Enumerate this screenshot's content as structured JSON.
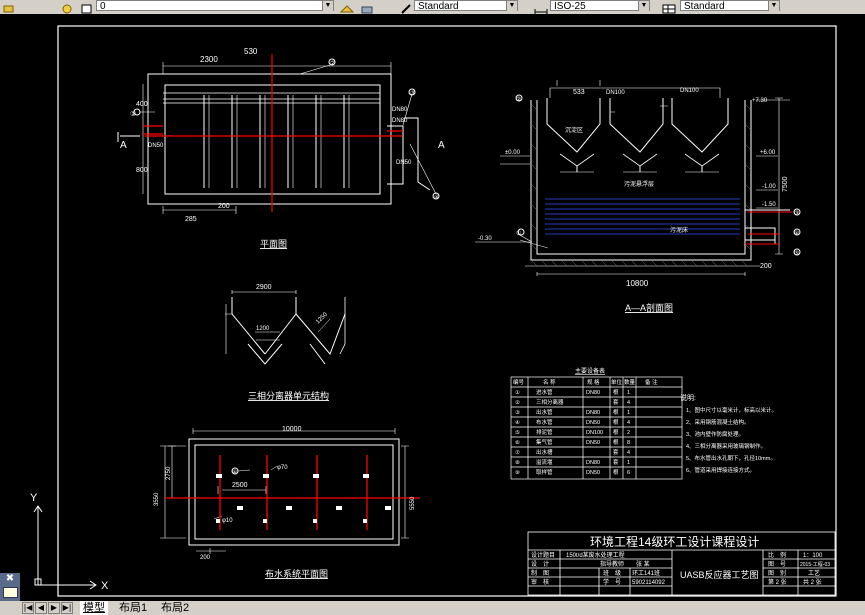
{
  "toolbar": {
    "layer_value": "0",
    "textstyle_value": "Standard",
    "dimstyle_value": "ISO-25",
    "tablestyle_value": "Standard"
  },
  "drawing": {
    "plan": {
      "title": "平面图",
      "dims": [
        "2300",
        "530",
        "400",
        "800",
        "200",
        "285"
      ],
      "pipe_labels": [
        "DN50",
        "DN80",
        "DN50",
        "DN80"
      ],
      "section_marks": [
        "A",
        "A"
      ],
      "callouts": [
        "①",
        "②",
        "③",
        "④"
      ]
    },
    "section": {
      "title": "A—A剖面图",
      "dims": [
        "533",
        "10800",
        "7500",
        "200"
      ],
      "elevations": [
        "+7.30",
        "+6.00",
        "-1.00",
        "-1.50",
        "±0.00",
        "-0.30"
      ],
      "labels": [
        "沉淀区",
        "DN100",
        "DN100",
        "污泥悬浮层",
        "污泥床"
      ],
      "callouts": [
        "①",
        "②",
        "③",
        "④",
        "⑤"
      ]
    },
    "separator": {
      "title": "三相分离器单元结构",
      "dims": [
        "2900",
        "1200",
        "1250"
      ]
    },
    "distribution": {
      "title": "布水系统平面图",
      "dims": [
        "10000",
        "2500",
        "2750",
        "3550",
        "5550",
        "200"
      ],
      "labels": [
        "φ70",
        "φ10"
      ],
      "callouts": [
        "④"
      ]
    },
    "parts_table": {
      "title": "主要设备表",
      "headers": [
        "编号",
        "名 称",
        "规 格",
        "单位",
        "数量",
        "备 注"
      ],
      "rows": [
        {
          "no": "①",
          "name": "进水管",
          "spec": "DN80",
          "unit": "根",
          "qty": "1"
        },
        {
          "no": "②",
          "name": "三相分离器",
          "spec": "",
          "unit": "套",
          "qty": "4"
        },
        {
          "no": "③",
          "name": "出水管",
          "spec": "DN80",
          "unit": "根",
          "qty": "1"
        },
        {
          "no": "④",
          "name": "布水管",
          "spec": "DN50",
          "unit": "根",
          "qty": "4"
        },
        {
          "no": "⑤",
          "name": "排泥管",
          "spec": "DN100",
          "unit": "根",
          "qty": "2"
        },
        {
          "no": "⑥",
          "name": "集气管",
          "spec": "DN50",
          "unit": "根",
          "qty": "8"
        },
        {
          "no": "⑦",
          "name": "出水槽",
          "spec": "",
          "unit": "套",
          "qty": "4"
        },
        {
          "no": "⑧",
          "name": "溢流堰",
          "spec": "DN80",
          "unit": "套",
          "qty": "1"
        },
        {
          "no": "⑨",
          "name": "取样管",
          "spec": "DN50",
          "unit": "根",
          "qty": "6"
        }
      ]
    },
    "notes": {
      "title": "说明:",
      "lines": [
        "1、图中尺寸以毫米计，标高以米计。",
        "2、采用钢筋混凝土结构。",
        "3、池内壁作防腐处理。",
        "4、三相分离器采用玻璃钢制作。",
        "5、布水管出水孔朝下，孔径10mm。",
        "6、管道采用焊接连接方式。"
      ]
    },
    "title_block": {
      "main_title": "环境工程14级环工设计课程设计",
      "subtitle": "150t/d某废水处理工程",
      "drawing_name": "UASB反应器工艺图",
      "left_cells": [
        "设计题目",
        "设　计",
        "制　图",
        "审　核"
      ],
      "mid_cells": [
        "指导教师",
        "班　级",
        "学　号",
        "张 某",
        "环工141班",
        "5902114092"
      ],
      "right_labels": [
        "比　例",
        "图　号",
        "图　别",
        "第 2 张"
      ],
      "right_values": [
        "1：100",
        "2015-工程-03",
        "工艺",
        "共 2 张"
      ]
    },
    "ucs": {
      "x_label": "X",
      "y_label": "Y"
    }
  },
  "nav": {
    "tabs": [
      "模型",
      "布局1",
      "布局2"
    ]
  }
}
